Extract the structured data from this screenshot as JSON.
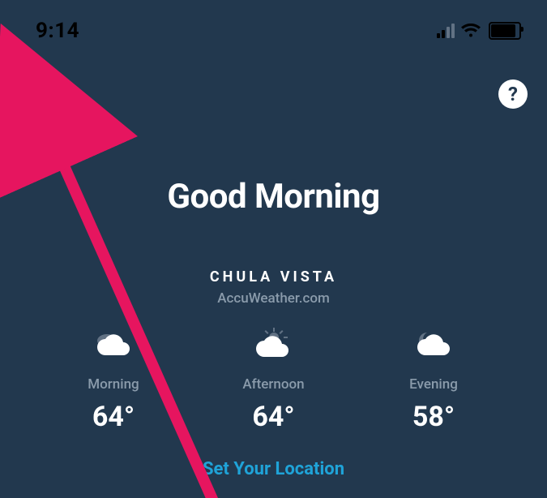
{
  "status": {
    "time": "9:14"
  },
  "header": {
    "help_label": "?"
  },
  "greeting": "Good Morning",
  "location": {
    "city": "CHULA VISTA",
    "source": "AccuWeather.com"
  },
  "forecast": {
    "slots": [
      {
        "icon": "cloud",
        "label": "Morning",
        "temp": "64°"
      },
      {
        "icon": "sun-cloud",
        "label": "Afternoon",
        "temp": "64°"
      },
      {
        "icon": "moon-cloud",
        "label": "Evening",
        "temp": "58°"
      }
    ]
  },
  "actions": {
    "set_location": "Set Your Location"
  }
}
